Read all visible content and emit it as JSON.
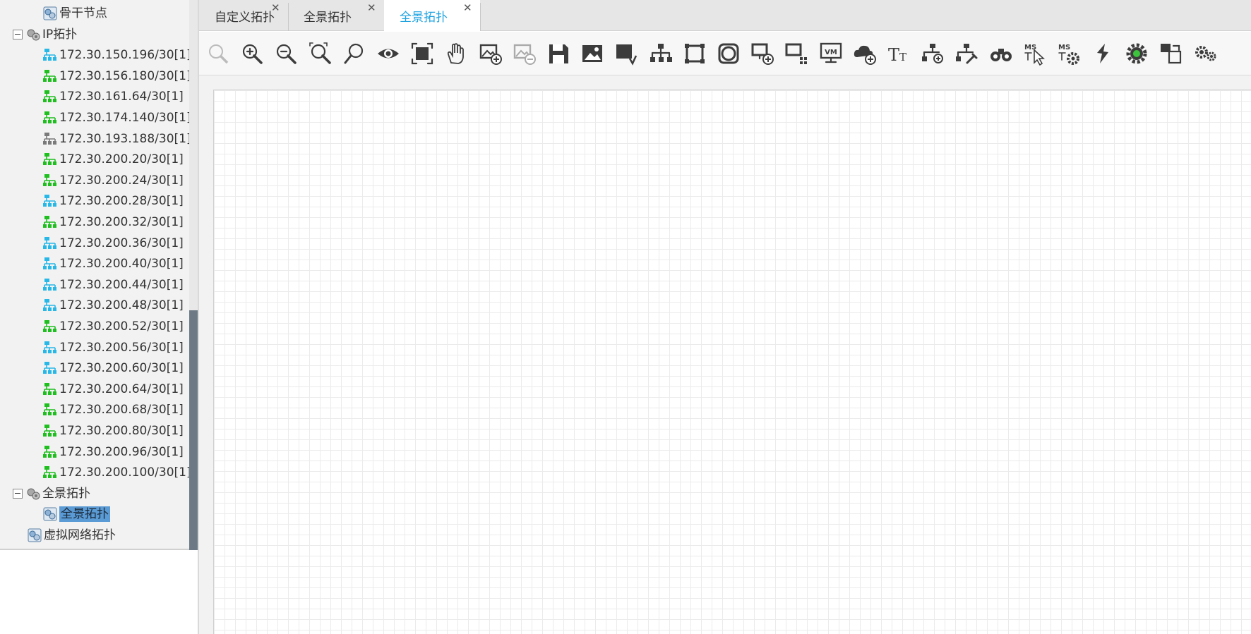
{
  "tree": {
    "items": [
      {
        "label": "骨干节点",
        "kind": "topo",
        "indent": 2
      },
      {
        "label": "IP拓扑",
        "kind": "group",
        "indent": 1,
        "expanded": true
      },
      {
        "label": "172.30.150.196/30[1]",
        "kind": "net-cyan",
        "indent": 2
      },
      {
        "label": "172.30.156.180/30[1]",
        "kind": "net-green",
        "indent": 2
      },
      {
        "label": "172.30.161.64/30[1]",
        "kind": "net-green",
        "indent": 2
      },
      {
        "label": "172.30.174.140/30[1]",
        "kind": "net-green",
        "indent": 2
      },
      {
        "label": "172.30.193.188/30[1]",
        "kind": "net-gray",
        "indent": 2
      },
      {
        "label": "172.30.200.20/30[1]",
        "kind": "net-green",
        "indent": 2
      },
      {
        "label": "172.30.200.24/30[1]",
        "kind": "net-green",
        "indent": 2
      },
      {
        "label": "172.30.200.28/30[1]",
        "kind": "net-cyan",
        "indent": 2
      },
      {
        "label": "172.30.200.32/30[1]",
        "kind": "net-green",
        "indent": 2
      },
      {
        "label": "172.30.200.36/30[1]",
        "kind": "net-cyan",
        "indent": 2
      },
      {
        "label": "172.30.200.40/30[1]",
        "kind": "net-cyan",
        "indent": 2
      },
      {
        "label": "172.30.200.44/30[1]",
        "kind": "net-cyan",
        "indent": 2
      },
      {
        "label": "172.30.200.48/30[1]",
        "kind": "net-cyan",
        "indent": 2
      },
      {
        "label": "172.30.200.52/30[1]",
        "kind": "net-green",
        "indent": 2
      },
      {
        "label": "172.30.200.56/30[1]",
        "kind": "net-cyan",
        "indent": 2
      },
      {
        "label": "172.30.200.60/30[1]",
        "kind": "net-cyan",
        "indent": 2
      },
      {
        "label": "172.30.200.64/30[1]",
        "kind": "net-green",
        "indent": 2
      },
      {
        "label": "172.30.200.68/30[1]",
        "kind": "net-green",
        "indent": 2
      },
      {
        "label": "172.30.200.80/30[1]",
        "kind": "net-green",
        "indent": 2
      },
      {
        "label": "172.30.200.96/30[1]",
        "kind": "net-green",
        "indent": 2
      },
      {
        "label": "172.30.200.100/30[1]",
        "kind": "net-green",
        "indent": 2
      },
      {
        "label": "全景拓扑",
        "kind": "group",
        "indent": 1,
        "expanded": true
      },
      {
        "label": "全景拓扑",
        "kind": "topo",
        "indent": 2,
        "selected": true
      },
      {
        "label": "虚拟网络拓扑",
        "kind": "topo",
        "indent": 1
      }
    ]
  },
  "tabs": [
    {
      "label": "自定义拓扑",
      "active": false
    },
    {
      "label": "全景拓扑",
      "active": false
    },
    {
      "label": "全景拓扑",
      "active": true
    }
  ],
  "toolbar": {
    "buttons": [
      "zoom-reset-icon",
      "zoom-in-icon",
      "zoom-out-icon",
      "zoom-fit-icon",
      "search-icon",
      "eye-icon",
      "fullscreen-icon",
      "hand-pan-icon",
      "image-add-icon",
      "image-remove-icon",
      "save-icon",
      "image-icon",
      "export-icon",
      "tree-layout-icon",
      "frame-square-icon",
      "frame-circle-icon",
      "node-add-icon",
      "node-grid-icon",
      "vm-icon",
      "cloud-add-icon",
      "text-icon",
      "link-add-icon",
      "link-tools-icon",
      "binoculars-icon",
      "ms-pointer-icon",
      "ms-settings-icon",
      "refresh-link-icon",
      "gear-green-icon",
      "layout-switch-icon",
      "settings-icon"
    ]
  },
  "colors": {
    "tab_active": "#20a3e0",
    "net_green": "#1fbf1f",
    "net_cyan": "#27b8e8",
    "net_gray": "#7a7a7a",
    "selection": "#5b9bd5"
  }
}
